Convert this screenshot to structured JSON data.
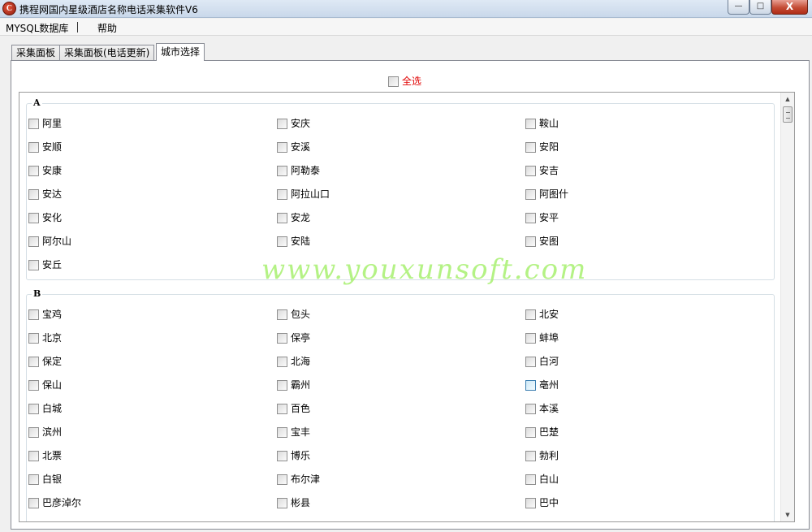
{
  "window": {
    "title": "携程网国内星级酒店名称电话采集软件V6",
    "app_icon": "C",
    "minimize": "—",
    "maximize": "□",
    "close": "X"
  },
  "menu": [
    "MYSQL数据库",
    "帮助"
  ],
  "tabs": [
    {
      "label": "采集面板",
      "active": false
    },
    {
      "label": "采集面板(电话更新)",
      "active": false
    },
    {
      "label": "城市选择",
      "active": true
    }
  ],
  "select_all": {
    "label": "全选",
    "checked": false
  },
  "groups": [
    {
      "letter": "A",
      "cities": [
        "阿里",
        "安庆",
        "鞍山",
        "安顺",
        "安溪",
        "安阳",
        "安康",
        "阿勒泰",
        "安吉",
        "安达",
        "阿拉山口",
        "阿图什",
        "安化",
        "安龙",
        "安平",
        "阿尔山",
        "安陆",
        "安图",
        "安丘"
      ]
    },
    {
      "letter": "B",
      "cities": [
        "宝鸡",
        "包头",
        "北安",
        "北京",
        "保亭",
        "蚌埠",
        "保定",
        "北海",
        "白河",
        "保山",
        "霸州",
        "亳州",
        "白城",
        "百色",
        "本溪",
        "滨州",
        "宝丰",
        "巴楚",
        "北票",
        "博乐",
        "勃利",
        "白银",
        "布尔津",
        "白山",
        "巴彦淖尔",
        "彬县",
        "巴中"
      ]
    }
  ],
  "watermark": "www.youxunsoft.com"
}
